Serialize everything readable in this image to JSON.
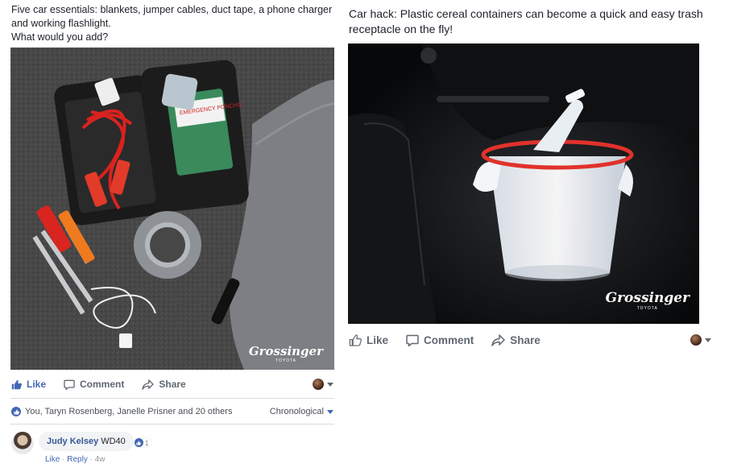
{
  "left_post": {
    "caption_line1": "Five car essentials: blankets, jumper cables, duct tape, a phone charger and working flashlight.",
    "caption_line2": "What would you add?",
    "watermark": "Grossinger",
    "watermark_sub": "TOYOTA",
    "kit_label": "EMERGENCY PONCHO",
    "actions": {
      "like": "Like",
      "comment": "Comment",
      "share": "Share"
    },
    "reactions_text": "You, Taryn Rosenberg, Janelle Prisner and 20 others",
    "order_label": "Chronological",
    "comment": {
      "author": "Judy Kelsey",
      "text": "WD40",
      "like_count": "1",
      "like_link": "Like",
      "reply_link": "Reply",
      "separator": "·",
      "time": "4w"
    }
  },
  "right_post": {
    "caption": "Car hack: Plastic cereal containers can become a quick and easy trash receptacle on the fly!",
    "watermark": "Grossinger",
    "watermark_sub": "TOYOTA",
    "actions": {
      "like": "Like",
      "comment": "Comment",
      "share": "Share"
    }
  },
  "colors": {
    "accent": "#4267b2",
    "link": "#385898",
    "muted": "#606770",
    "divider": "#dadde1"
  }
}
